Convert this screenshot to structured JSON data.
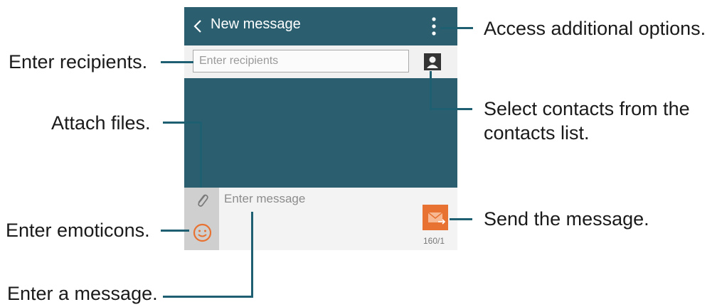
{
  "screen": {
    "title": "New message",
    "recipients_placeholder": "Enter recipients",
    "message_placeholder": "Enter message",
    "counter": "160/1"
  },
  "icons": {
    "back": "back-chevron-icon",
    "more": "more-vertical-icon",
    "contacts": "contact-card-icon",
    "attach": "paperclip-icon",
    "emoticon": "smiley-icon",
    "send": "envelope-send-icon"
  },
  "callouts": {
    "options": "Access additional options.",
    "recipients": "Enter recipients.",
    "contacts_line1": "Select contacts from the",
    "contacts_line2": "contacts list.",
    "attach": "Attach files.",
    "emoticons": "Enter emoticons.",
    "send": "Send the message.",
    "message": "Enter a message."
  },
  "colors": {
    "header_teal": "#2b5f70",
    "send_orange": "#e87232",
    "callout_line": "#1f5f72"
  }
}
